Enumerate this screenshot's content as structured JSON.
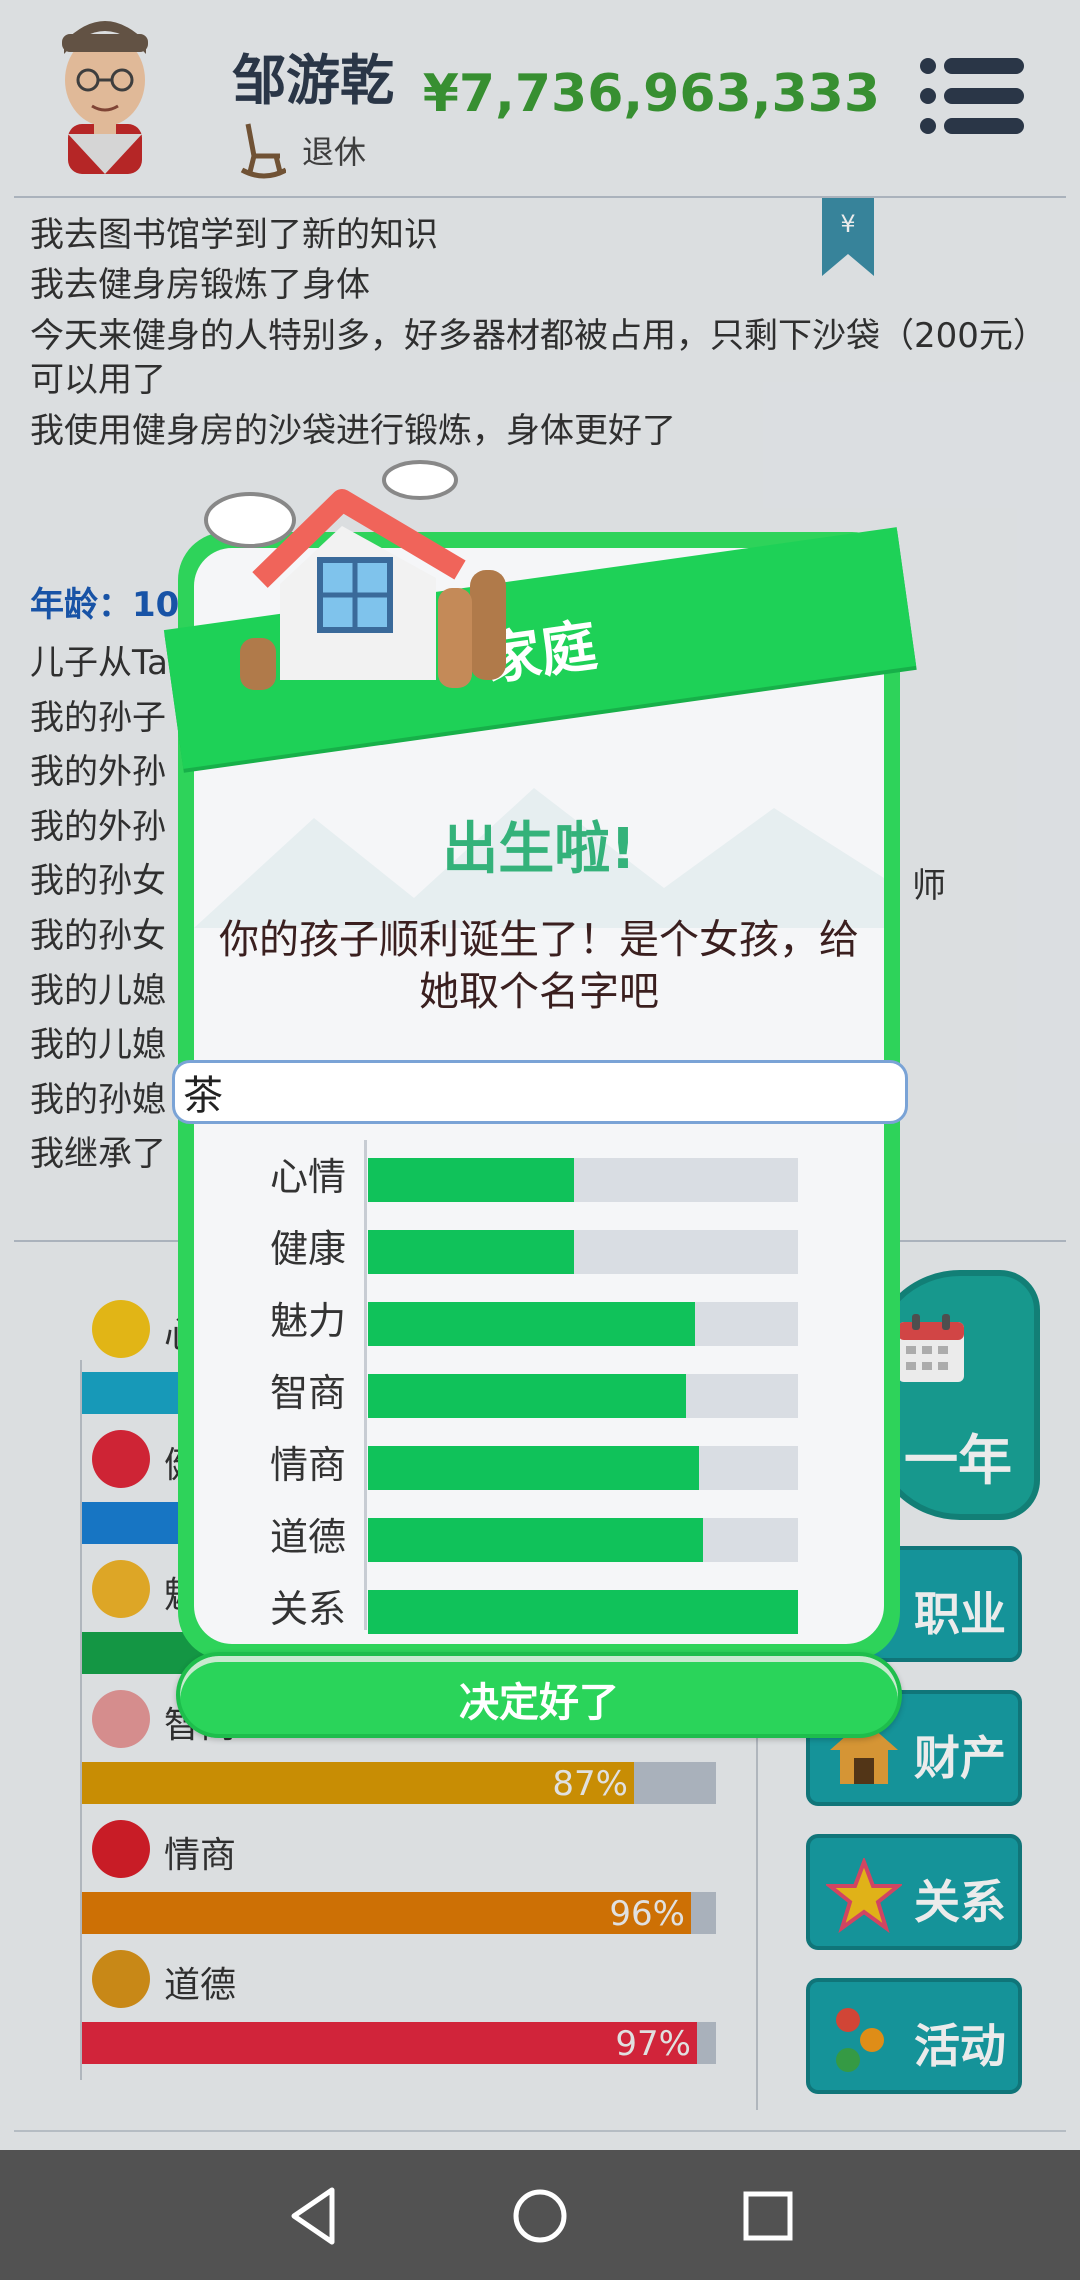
{
  "header": {
    "player_name": "邹游乾",
    "status": "退休",
    "money": "¥7,736,963,333"
  },
  "log": {
    "lines": [
      "我去图书馆学到了新的知识",
      "我去健身房锻炼了身体",
      "今天来健身的人特别多，好多器材都被占用，只剩下沙袋（200元）可以用了",
      "我使用健身房的沙袋进行锻炼，身体更好了"
    ],
    "age_label": "年龄：10",
    "lines2": [
      "儿子从Ta",
      "我的孙子",
      "我的外孙",
      "我的外孙",
      "我的孙女",
      "我的孙女",
      "我的儿媳",
      "我的儿媳",
      "我的孙媳",
      "我继承了"
    ],
    "tail_text": "师"
  },
  "stats": [
    {
      "name": "心",
      "percent": "",
      "value": 1.0,
      "color": "#1aa6c8"
    },
    {
      "name": "健",
      "percent": "",
      "value": 1.0,
      "color": "#1a7fd4"
    },
    {
      "name": "魅",
      "percent": "",
      "value": 1.0,
      "color": "#16a34a"
    },
    {
      "name": "智商",
      "percent": "87%",
      "value": 0.87,
      "color": "#d99a05"
    },
    {
      "name": "情商",
      "percent": "96%",
      "value": 0.96,
      "color": "#df7a06"
    },
    {
      "name": "道德",
      "percent": "97%",
      "value": 0.97,
      "color": "#e3283f"
    }
  ],
  "side_buttons": {
    "next_year": "一年",
    "career": "职业",
    "property": "财产",
    "relation": "关系",
    "activity": "活动"
  },
  "modal": {
    "ribbon": "家庭",
    "title": "出生啦!",
    "message": "你的孩子顺利诞生了！是个女孩，给她取个名字吧",
    "name_value": "茶",
    "attributes": [
      {
        "name": "心情",
        "value": 0.48
      },
      {
        "name": "健康",
        "value": 0.48
      },
      {
        "name": "魅力",
        "value": 0.76
      },
      {
        "name": "智商",
        "value": 0.74
      },
      {
        "name": "情商",
        "value": 0.77
      },
      {
        "name": "道德",
        "value": 0.78
      },
      {
        "name": "关系",
        "value": 1.0
      }
    ],
    "confirm_label": "决定好了"
  }
}
